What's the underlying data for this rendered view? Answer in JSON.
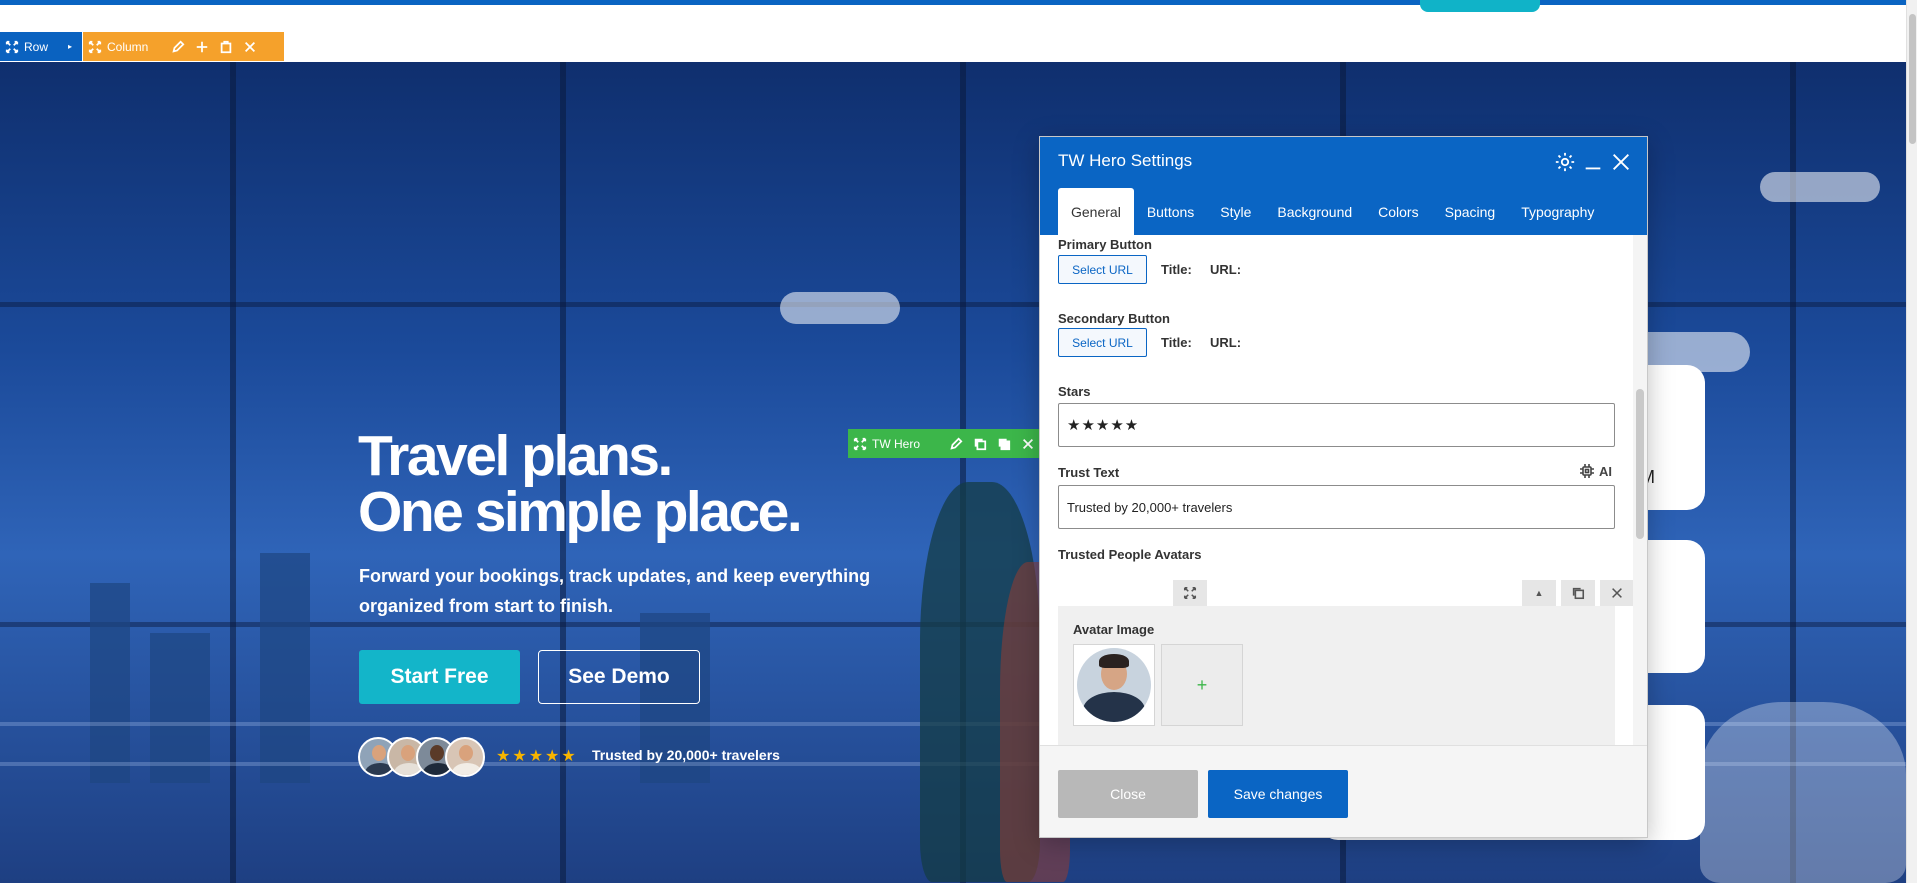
{
  "editor": {
    "row_label": "Row",
    "column_label": "Column",
    "module_label": "TW Hero"
  },
  "hero": {
    "title_line1": "Travel plans.",
    "title_line2": "One simple place.",
    "subtitle": "Forward your bookings, track updates, and keep everything organized from start to finish.",
    "primary_button": "Start Free",
    "secondary_button": "See Demo",
    "stars": "★★★★★",
    "trust_text": "Trusted by 20,000+ travelers",
    "card_fragment": "M"
  },
  "dialog": {
    "title": "TW Hero Settings",
    "tabs": [
      {
        "label": "General"
      },
      {
        "label": "Buttons"
      },
      {
        "label": "Style"
      },
      {
        "label": "Background"
      },
      {
        "label": "Colors"
      },
      {
        "label": "Spacing"
      },
      {
        "label": "Typography"
      }
    ],
    "primary_button": {
      "label": "Primary Button",
      "select_url": "Select URL",
      "title_label": "Title:",
      "url_label": "URL:"
    },
    "secondary_button": {
      "label": "Secondary Button",
      "select_url": "Select URL",
      "title_label": "Title:",
      "url_label": "URL:"
    },
    "stars": {
      "label": "Stars",
      "value": "★★★★★"
    },
    "trust_text": {
      "label": "Trust Text",
      "ai_label": "AI",
      "value": "Trusted by 20,000+ travelers"
    },
    "avatars": {
      "label": "Trusted People Avatars",
      "item_label": "Avatar Image",
      "add_symbol": "+"
    },
    "footer": {
      "close": "Close",
      "save": "Save changes"
    }
  },
  "colors": {
    "brand_blue": "#0a65c4",
    "column_orange": "#f5a12b",
    "module_green": "#3cb64a",
    "cta_teal": "#13b5c9",
    "star_gold": "#f7b500"
  }
}
